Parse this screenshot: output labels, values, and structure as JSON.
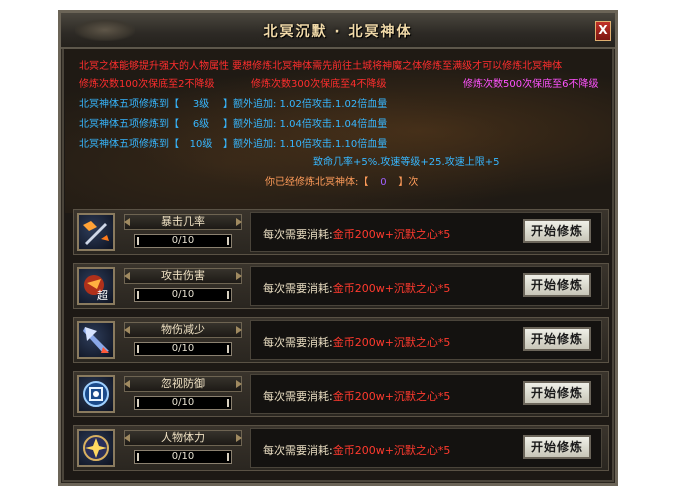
{
  "window": {
    "title": "北冥沉默 · 北冥神体",
    "close_label": "X"
  },
  "info": {
    "intro": "北冥之体能够提升强大的人物属性 要想修炼北冥神体需先前往土城将神魔之体修炼至满级才可以修炼北冥神体",
    "guarantee_100": "修炼次数100次保底至2不降级",
    "guarantee_300": "修炼次数300次保底至4不降级",
    "guarantee_500": "修炼次数500次保底至6不降级",
    "bonus_lines": [
      {
        "prefix": "北冥神体五项修炼到【",
        "level": "3级",
        "suffix": "】额外追加: 1.02倍攻击.1.02倍血量"
      },
      {
        "prefix": "北冥神体五项修炼到【",
        "level": "6级",
        "suffix": "】额外追加: 1.04倍攻击.1.04倍血量"
      },
      {
        "prefix": "北冥神体五项修炼到【",
        "level": "10级",
        "suffix": "】额外追加: 1.10倍攻击.1.10倍血量"
      }
    ],
    "extra_bonus": "致命几率+5%.攻速等级+25.攻速上限+5",
    "count_prefix": "你已经修炼北冥神体:【",
    "count_value": "0",
    "count_suffix": "】次"
  },
  "rows": [
    {
      "name": "暴击几率",
      "progress": "0/10",
      "progress_value": 0,
      "progress_max": 10,
      "icon": "crit-sword-icon",
      "cost_label": "每次需要消耗:",
      "cost_value": "金币200w+沉默之心*5",
      "button": "开始修炼"
    },
    {
      "name": "攻击伤害",
      "progress": "0/10",
      "progress_value": 0,
      "progress_max": 10,
      "icon": "attack-super-icon",
      "cost_label": "每次需要消耗:",
      "cost_value": "金币200w+沉默之心*5",
      "button": "开始修炼"
    },
    {
      "name": "物伤减少",
      "progress": "0/10",
      "progress_value": 0,
      "progress_max": 10,
      "icon": "arrow-defense-icon",
      "cost_label": "每次需要消耗:",
      "cost_value": "金币200w+沉默之心*5",
      "button": "开始修炼"
    },
    {
      "name": "忽视防御",
      "progress": "0/10",
      "progress_value": 0,
      "progress_max": 10,
      "icon": "ignore-defense-icon",
      "cost_label": "每次需要消耗:",
      "cost_value": "金币200w+沉默之心*5",
      "button": "开始修炼"
    },
    {
      "name": "人物体力",
      "progress": "0/10",
      "progress_value": 0,
      "progress_max": 10,
      "icon": "vitality-star-icon",
      "cost_label": "每次需要消耗:",
      "cost_value": "金币200w+沉默之心*5",
      "button": "开始修炼"
    }
  ],
  "colors": {
    "red_text": "#ff2e2e",
    "cyan_text": "#37b7ff",
    "magenta_text": "#ff52ff",
    "yellow_text": "#f5d36a"
  }
}
